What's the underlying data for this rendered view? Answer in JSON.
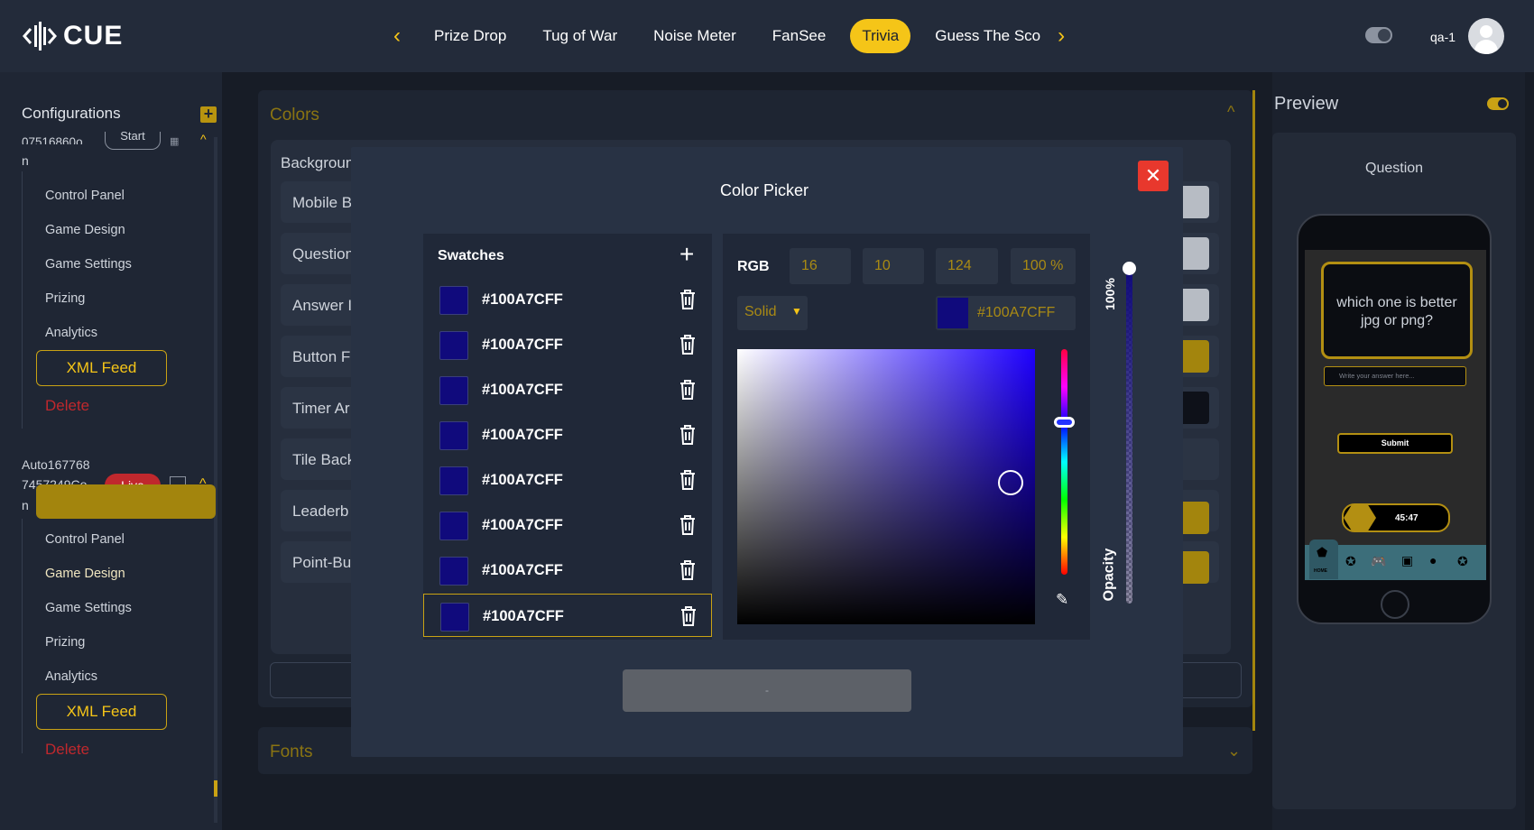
{
  "nav": {
    "logo_text": "CUE",
    "tabs": [
      "Prize Drop",
      "Tug of War",
      "Noise Meter",
      "FanSee",
      "Trivia",
      "Guess The Sco"
    ],
    "active_tab": "Trivia",
    "username": "qa-1"
  },
  "sidebar": {
    "title": "Configurations",
    "config1_id_fragment": "07516860o",
    "config1_status": "Start",
    "config1_tail": "n",
    "config1_items": [
      "Control Panel",
      "Game Design",
      "Game Settings",
      "Prizing",
      "Analytics"
    ],
    "xml_feed_label": "XML Feed",
    "delete_label": "Delete",
    "config2_id_line1": "Auto167768",
    "config2_id_line2": "7457249Co",
    "config2_id_line3": "n",
    "config2_status": "Live",
    "config2_items": [
      "Control Panel",
      "Game Design",
      "Game Settings",
      "Prizing",
      "Analytics"
    ]
  },
  "main": {
    "colors_title": "Colors",
    "rows": [
      "Backgroun",
      "Mobile B",
      "Question",
      "Answer I",
      "Button F",
      "Timer Ar",
      "Tile Back",
      "Leaderb",
      "Point-Bu"
    ],
    "fonts_title": "Fonts"
  },
  "preview": {
    "title": "Preview",
    "section": "Question",
    "question_text": "which one is better jpg or png?",
    "answer_placeholder": "Write your answer here...",
    "submit_label": "Submit",
    "timer": "45:47",
    "home_label": "HOME"
  },
  "modal": {
    "title": "Color Picker",
    "swatches_title": "Swatches",
    "swatches": [
      "#100A7CFF",
      "#100A7CFF",
      "#100A7CFF",
      "#100A7CFF",
      "#100A7CFF",
      "#100A7CFF",
      "#100A7CFF",
      "#100A7CFF"
    ],
    "selected_swatch_index": 7,
    "mode_label": "RGB",
    "r": "16",
    "g": "10",
    "b": "124",
    "alpha": "100 %",
    "fill_type": "Solid",
    "hex_value": "#100A7CFF",
    "opacity_label": "Opacity",
    "opacity_value": "100%",
    "confirm_label": "-"
  },
  "colors": {
    "accent": "#f5c518",
    "selected_color": "#100a7c",
    "close_red": "#e8382d",
    "delete_red": "#c0282d"
  }
}
